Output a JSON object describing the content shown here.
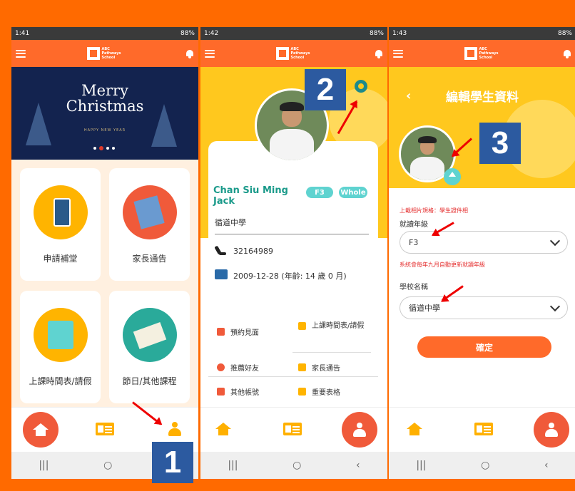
{
  "panel1": {
    "status_time": "1:41",
    "status_right": "88%",
    "school_logo_text": "ABC Pathways School",
    "banner": {
      "title_line1": "Merry",
      "title_line2": "Christmas",
      "sub": "HAPPY NEW YEAR"
    },
    "tiles": [
      "申請補堂",
      "家長通告",
      "上課時間表/請假",
      "節日/其他課程"
    ],
    "step": "1"
  },
  "panel2": {
    "status_time": "1:42",
    "status_right": "88%",
    "student_name": "Chan Siu Ming Jack",
    "grade_pill": "F3",
    "type_pill": "Whole",
    "school": "循道中學",
    "phone": "32164989",
    "dob": "2009-12-28 (年齡: 14 歲 0 月)",
    "menu": [
      "預約見面",
      "上課時間表/請假",
      "推薦好友",
      "家長通告",
      "其他帳號",
      "重要表格"
    ],
    "step": "2"
  },
  "panel3": {
    "status_time": "1:43",
    "status_right": "88%",
    "title": "編輯學生資料",
    "photo_note": "上載相片規格：學生證件相",
    "grade_label": "就讀年級",
    "grade_value": "F3",
    "grade_note": "系統會每年九月自動更新就讀年級",
    "school_label": "學校名稱",
    "school_value": "循道中學",
    "confirm": "確定",
    "step": "3"
  },
  "nav_glyphs": {
    "recent": "|||",
    "home": "○",
    "back": "‹"
  },
  "colors": {
    "frame": "#ff6a00",
    "appbar": "#ff6a2a",
    "accent_yellow": "#ffc81e",
    "teal": "#1a9a8a",
    "badge": "#2c5aa0"
  }
}
